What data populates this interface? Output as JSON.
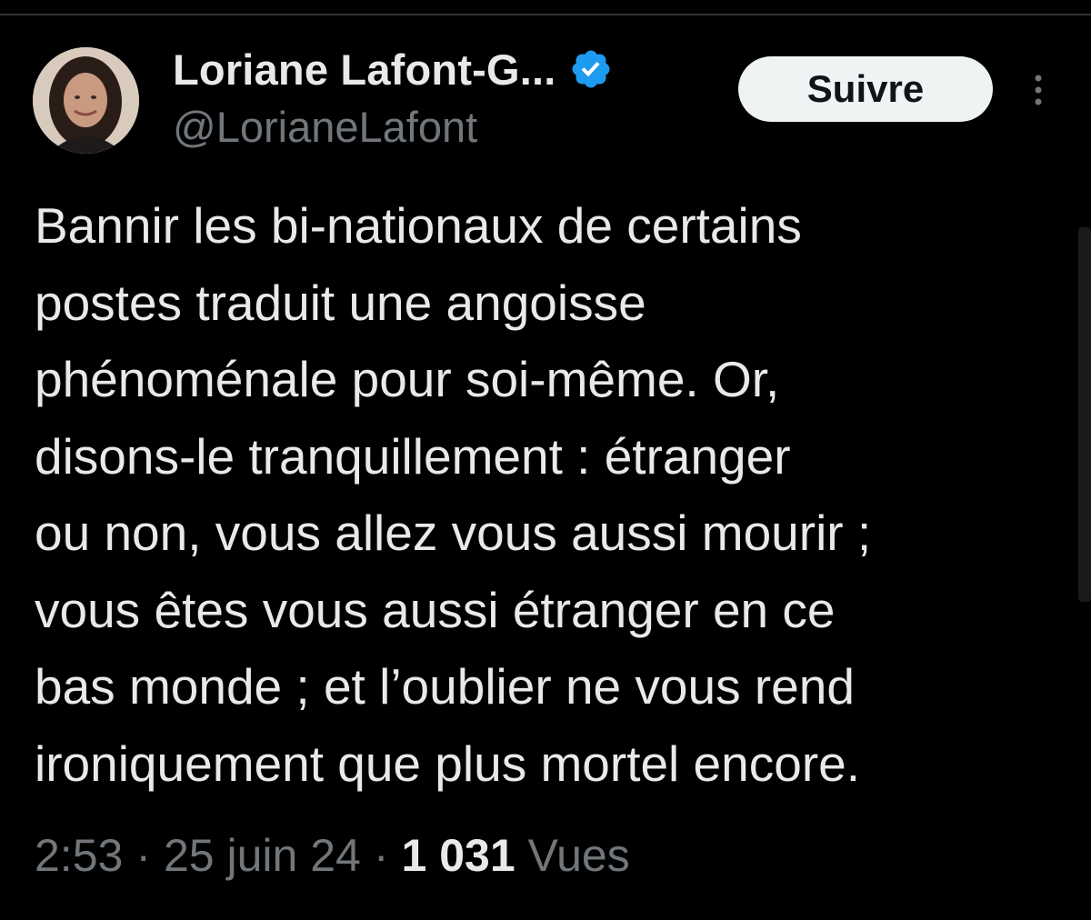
{
  "author": {
    "display_name": "Loriane Lafont-G...",
    "handle": "@LorianeLafont",
    "verified_color": "#1d9bf0"
  },
  "actions": {
    "follow_label": "Suivre"
  },
  "icons": {
    "verified": "verified-badge-icon",
    "more": "more-vertical-icon",
    "avatar": "profile-photo"
  },
  "tweet": {
    "text": "Bannir les bi-nationaux de certains\npostes traduit une angoisse\nphénoménale pour soi-même. Or,\ndisons-le tranquillement : étranger\nou non, vous allez vous aussi mourir ;\nvous êtes vous aussi étranger en ce\nbas monde ; et l’oublier ne vous rend\nironiquement que plus mortel encore."
  },
  "meta": {
    "time": "2:53",
    "separator": "·",
    "date": "25 juin 24",
    "views_count": "1 031",
    "views_label": "Vues"
  },
  "colors": {
    "background": "#000000",
    "text": "#e7e9ea",
    "secondary_text": "#71767b",
    "button_bg": "#eff3f4"
  }
}
